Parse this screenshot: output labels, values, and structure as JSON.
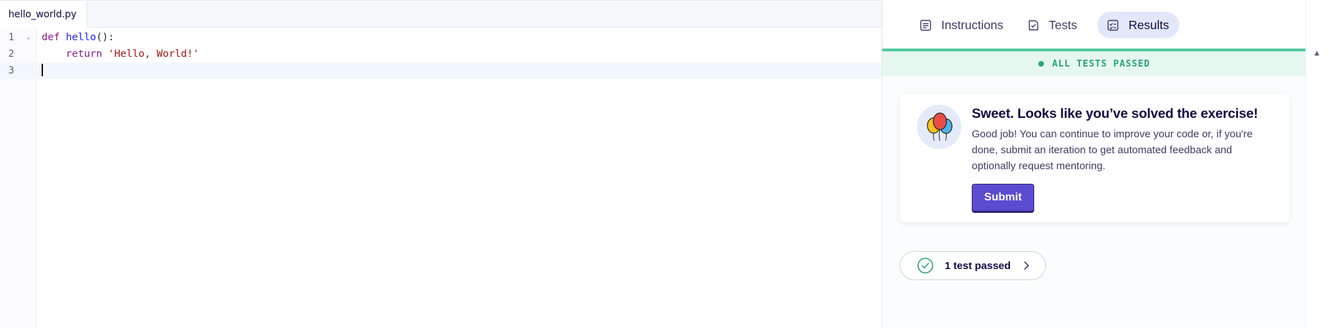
{
  "editor": {
    "file_tab": "hello_world.py",
    "lines": [
      {
        "number": "1",
        "kw": "def ",
        "fn": "hello",
        "rest": "():"
      },
      {
        "number": "2",
        "indent": "    ",
        "kw": "return ",
        "str": "'Hello, World!'"
      },
      {
        "number": "3"
      }
    ],
    "fold_marker": "⌄"
  },
  "panel": {
    "tabs": [
      {
        "label": "Instructions",
        "icon": "instructions-icon",
        "active": false
      },
      {
        "label": "Tests",
        "icon": "tests-icon",
        "active": false
      },
      {
        "label": "Results",
        "icon": "results-icon",
        "active": true
      }
    ],
    "status": "ALL TESTS PASSED",
    "card": {
      "icon": "balloons-icon",
      "title": "Sweet. Looks like you’ve solved the exercise!",
      "text": "Good job! You can continue to improve your code or, if you're done, submit an iteration to get automated feedback and optionally request mentoring.",
      "submit_label": "Submit"
    },
    "tests_summary": {
      "label": "1 test passed",
      "icon": "check-circle-icon"
    }
  },
  "colors": {
    "accent": "#5a4bd0",
    "success": "#27a37a",
    "success_bg": "#e6f7ef",
    "active_tab_bg": "#e2e8fa"
  }
}
